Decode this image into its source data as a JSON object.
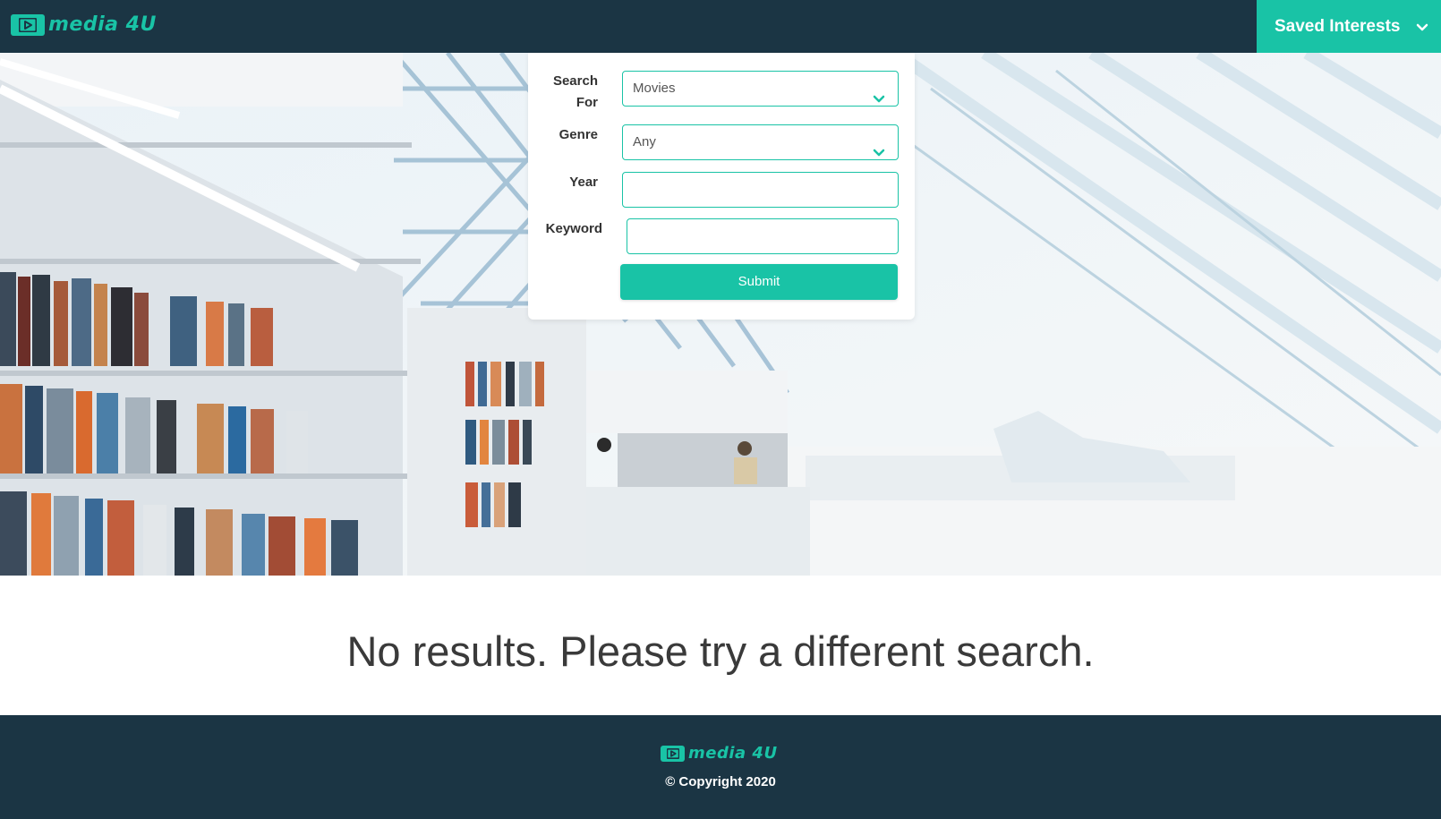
{
  "header": {
    "logo_text": "media 4U",
    "saved_interests_label": "Saved Interests"
  },
  "search_form": {
    "search_for": {
      "label": "Search For",
      "value": "Movies"
    },
    "genre": {
      "label": "Genre",
      "value": "Any"
    },
    "year": {
      "label": "Year",
      "value": ""
    },
    "keyword": {
      "label": "Keyword",
      "value": ""
    },
    "submit_label": "Submit"
  },
  "results": {
    "message": "No results. Please try a different search."
  },
  "footer": {
    "logo_text": "media 4U",
    "copyright": "© Copyright 2020"
  },
  "colors": {
    "accent": "#19c3a6",
    "navy": "#1b3544"
  },
  "icons": [
    "play-logo-icon",
    "chevron-down-icon"
  ]
}
